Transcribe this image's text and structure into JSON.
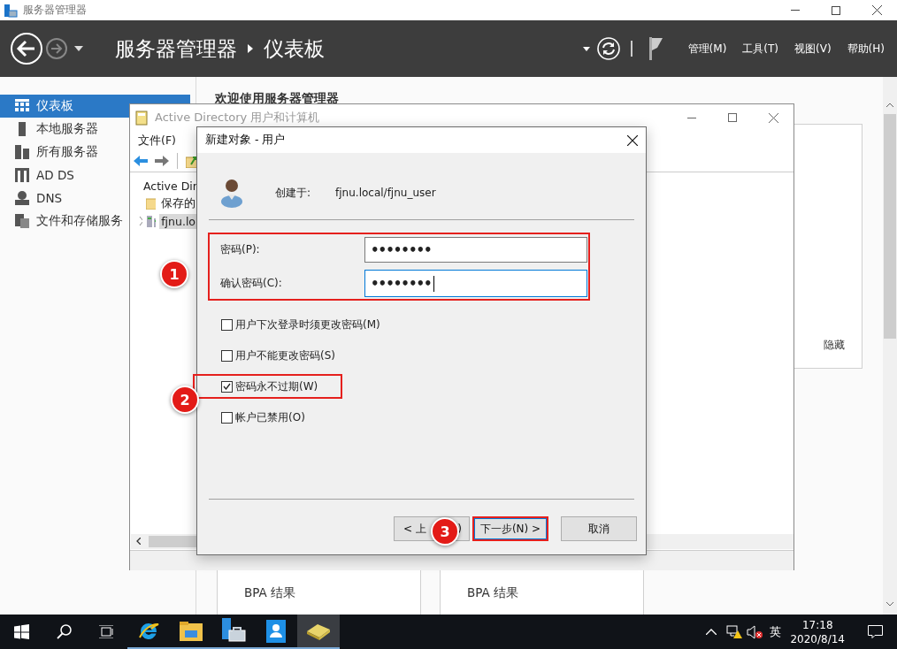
{
  "window": {
    "title": "服务器管理器"
  },
  "header": {
    "breadcrumb": [
      "服务器管理器",
      "仪表板"
    ],
    "menus": [
      "管理(M)",
      "工具(T)",
      "视图(V)",
      "帮助(H)"
    ]
  },
  "sidebar": {
    "items": [
      {
        "kind": "dashboard",
        "label": "仪表板",
        "selected": true
      },
      {
        "kind": "server",
        "label": "本地服务器",
        "selected": false
      },
      {
        "kind": "servers",
        "label": "所有服务器",
        "selected": false
      },
      {
        "kind": "adds",
        "label": "AD DS",
        "selected": false
      },
      {
        "kind": "dns",
        "label": "DNS",
        "selected": false
      },
      {
        "kind": "files",
        "label": "文件和存储服务",
        "selected": false
      }
    ]
  },
  "content": {
    "welcome": "欢迎使用服务器管理器",
    "panel_link": "隐藏",
    "tiles": [
      {
        "line_2": "BPA 结果"
      },
      {
        "line_2": "BPA 结果"
      }
    ]
  },
  "ad_window": {
    "title": "Active Directory 用户和计算机",
    "menus": [
      "文件(F)"
    ],
    "tree": [
      {
        "label": "Active Dir",
        "selected": false,
        "children": [
          {
            "label": "保存的",
            "selected": false
          },
          {
            "label": "fjnu.lo",
            "selected": true,
            "expanded": false
          }
        ]
      }
    ]
  },
  "dialog": {
    "title": "新建对象 - 用户",
    "created_label": "创建于:",
    "created_in": "fjnu.local/fjnu_user",
    "fields_highlighted": true,
    "fields": [
      {
        "label": "密码(P):",
        "value": "••••••••",
        "focused": false
      },
      {
        "label": "确认密码(C):",
        "value": "••••••••",
        "focused": true
      }
    ],
    "checkboxes": [
      {
        "label": "用户下次登录时须更改密码(M)",
        "checked": false,
        "highlighted": false
      },
      {
        "label": "用户不能更改密码(S)",
        "checked": false,
        "highlighted": false
      },
      {
        "label": "密码永不过期(W)",
        "checked": true,
        "highlighted": true
      },
      {
        "label": "帐户已禁用(O)",
        "checked": false,
        "highlighted": false
      }
    ],
    "buttons": [
      {
        "kind": "back",
        "label_start": "< 上",
        "label_end": ")",
        "highlighted": false
      },
      {
        "kind": "next",
        "label": "下一步(N) >",
        "highlighted": true
      },
      {
        "kind": "cancel",
        "label": "取消",
        "highlighted": false
      }
    ]
  },
  "annotations": [
    {
      "number": "1"
    },
    {
      "number": "2"
    },
    {
      "number": "3"
    }
  ],
  "taskbar": {
    "apps": [
      {
        "kind": "browser",
        "selected": false
      },
      {
        "kind": "folder",
        "selected": false
      },
      {
        "kind": "server-manager",
        "selected": false
      },
      {
        "kind": "contacts",
        "selected": false
      },
      {
        "kind": "directory",
        "selected": true
      }
    ],
    "ime": "英",
    "time": "17:18",
    "date": "2020/8/14"
  }
}
